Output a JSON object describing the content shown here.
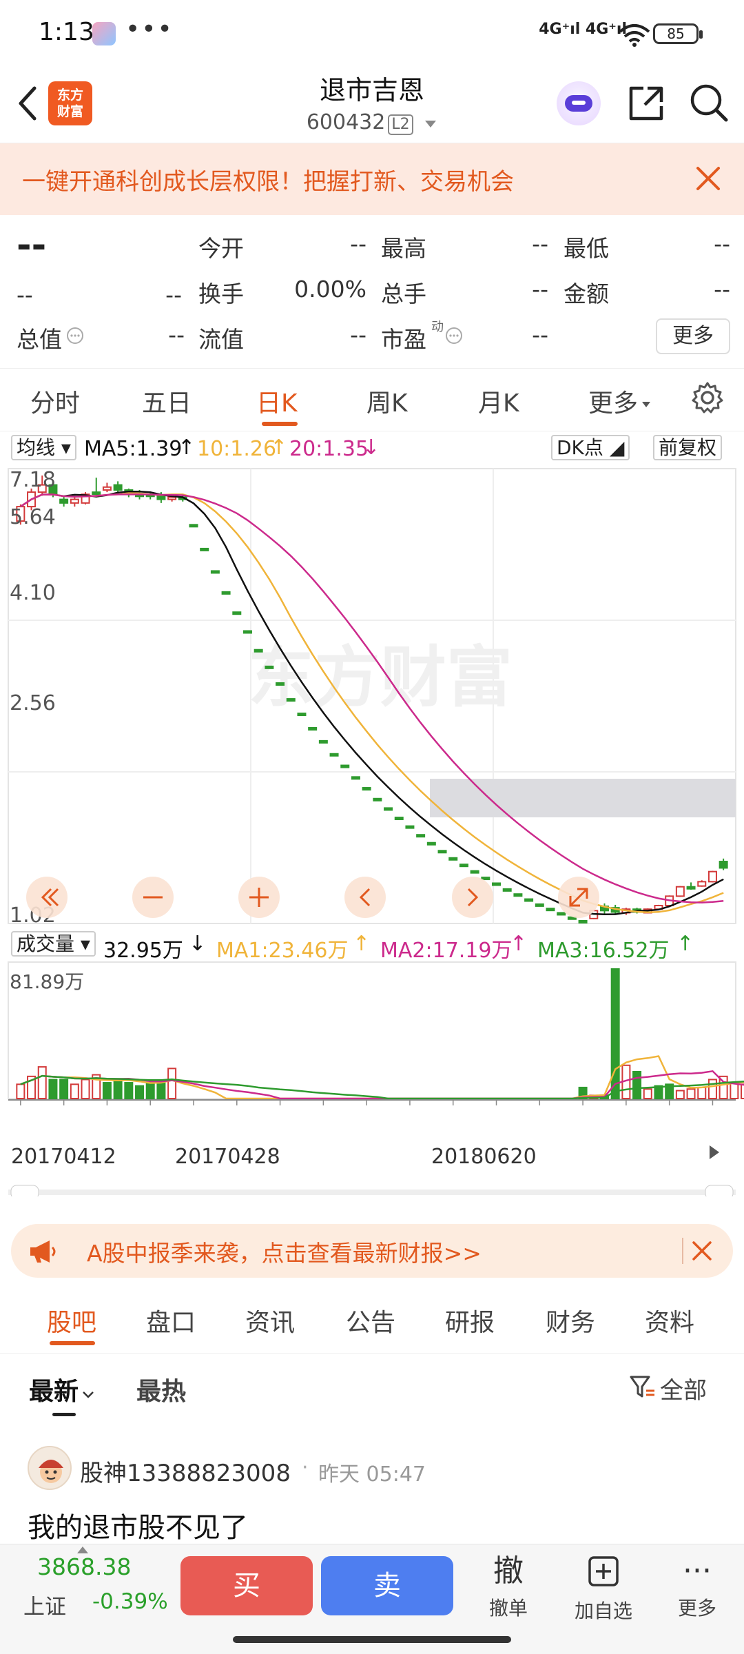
{
  "status_bar": {
    "time": "1:13",
    "dots": "•••",
    "network": "4G⁺ıl 4G⁺ıl",
    "battery": "85"
  },
  "header": {
    "logo_line1": "东方",
    "logo_line2": "财富",
    "stock_name": "退市吉恩",
    "stock_code": "600432",
    "level_badge": "L2"
  },
  "banner_top": {
    "text": "一键开通科创成长层权限！把握打新、交易机会"
  },
  "quote": {
    "price": "--",
    "change": "--",
    "change_pct": "--",
    "rows": [
      [
        {
          "label": "今开",
          "value": "--"
        },
        {
          "label": "最高",
          "value": "--"
        },
        {
          "label": "最低",
          "value": "--"
        }
      ],
      [
        {
          "label": "换手",
          "value": "0.00%"
        },
        {
          "label": "总手",
          "value": "--"
        },
        {
          "label": "金额",
          "value": "--"
        }
      ],
      [
        {
          "label": "流值",
          "value": "--"
        },
        {
          "label": "市盈",
          "value": "--"
        }
      ]
    ],
    "total_value_label": "总值",
    "total_value": "--",
    "pe_sup": "动",
    "more_label": "更多"
  },
  "k_tabs": [
    {
      "label": "分时"
    },
    {
      "label": "五日"
    },
    {
      "label": "日K"
    },
    {
      "label": "周K"
    },
    {
      "label": "月K"
    },
    {
      "label": "更多"
    }
  ],
  "ma_bar": {
    "selector": "均线",
    "ma5": "MA5:1.39",
    "ma10": "10:1.26",
    "ma20": "20:1.35",
    "dk": "DK点",
    "adjust": "前复权"
  },
  "colors": {
    "up": "#d33a3a",
    "down": "#2e9b2e",
    "ma5": "#111111",
    "ma10": "#f0b43a",
    "ma20": "#cc2a8c",
    "accent": "#e2591f"
  },
  "chart_data": [
    {
      "type": "candlestick",
      "y_labels": [
        "7.18",
        "5.64",
        "4.10",
        "2.56",
        "1.02"
      ],
      "ylim": [
        1.02,
        7.18
      ],
      "watermark": "东方财富",
      "candles": [
        {
          "o": 6.55,
          "c": 6.75,
          "h": 6.78,
          "l": 6.5
        },
        {
          "o": 6.75,
          "c": 6.95,
          "h": 7.0,
          "l": 6.7
        },
        {
          "o": 6.95,
          "c": 7.05,
          "h": 7.18,
          "l": 6.9
        },
        {
          "o": 7.05,
          "c": 6.92,
          "h": 7.1,
          "l": 6.88
        },
        {
          "o": 6.85,
          "c": 6.8,
          "h": 6.9,
          "l": 6.75
        },
        {
          "o": 6.8,
          "c": 6.85,
          "h": 6.9,
          "l": 6.75
        },
        {
          "o": 6.8,
          "c": 6.92,
          "h": 6.95,
          "l": 6.78
        },
        {
          "o": 6.95,
          "c": 6.95,
          "h": 7.15,
          "l": 6.9
        },
        {
          "o": 6.98,
          "c": 7.02,
          "h": 7.08,
          "l": 6.95
        },
        {
          "o": 7.05,
          "c": 6.98,
          "h": 7.1,
          "l": 6.95
        },
        {
          "o": 6.98,
          "c": 6.92,
          "h": 7.0,
          "l": 6.88
        },
        {
          "o": 6.92,
          "c": 6.92,
          "h": 6.98,
          "l": 6.85
        },
        {
          "o": 6.92,
          "c": 6.9,
          "h": 6.95,
          "l": 6.85
        },
        {
          "o": 6.9,
          "c": 6.85,
          "h": 6.95,
          "l": 6.8
        },
        {
          "o": 6.85,
          "c": 6.88,
          "h": 6.9,
          "l": 6.82
        },
        {
          "o": 6.88,
          "c": 6.85,
          "h": 6.9,
          "l": 6.82
        },
        {
          "o": 6.5,
          "c": 6.5,
          "h": 6.5,
          "l": 6.5
        },
        {
          "o": 6.17,
          "c": 6.17,
          "h": 6.17,
          "l": 6.17
        },
        {
          "o": 5.86,
          "c": 5.86,
          "h": 5.86,
          "l": 5.86
        },
        {
          "o": 5.57,
          "c": 5.57,
          "h": 5.57,
          "l": 5.57
        },
        {
          "o": 5.29,
          "c": 5.29,
          "h": 5.29,
          "l": 5.29
        },
        {
          "o": 5.03,
          "c": 5.03,
          "h": 5.03,
          "l": 5.03
        },
        {
          "o": 4.77,
          "c": 4.77,
          "h": 4.77,
          "l": 4.77
        },
        {
          "o": 4.54,
          "c": 4.54,
          "h": 4.54,
          "l": 4.54
        },
        {
          "o": 4.31,
          "c": 4.31,
          "h": 4.31,
          "l": 4.31
        },
        {
          "o": 4.09,
          "c": 4.09,
          "h": 4.09,
          "l": 4.09
        },
        {
          "o": 3.89,
          "c": 3.89,
          "h": 3.89,
          "l": 3.89
        },
        {
          "o": 3.69,
          "c": 3.69,
          "h": 3.69,
          "l": 3.69
        },
        {
          "o": 3.51,
          "c": 3.51,
          "h": 3.51,
          "l": 3.51
        },
        {
          "o": 3.33,
          "c": 3.33,
          "h": 3.33,
          "l": 3.33
        },
        {
          "o": 3.17,
          "c": 3.17,
          "h": 3.17,
          "l": 3.17
        },
        {
          "o": 3.01,
          "c": 3.01,
          "h": 3.01,
          "l": 3.01
        },
        {
          "o": 2.86,
          "c": 2.86,
          "h": 2.86,
          "l": 2.86
        },
        {
          "o": 2.71,
          "c": 2.71,
          "h": 2.71,
          "l": 2.71
        },
        {
          "o": 2.58,
          "c": 2.58,
          "h": 2.58,
          "l": 2.58
        },
        {
          "o": 2.45,
          "c": 2.45,
          "h": 2.45,
          "l": 2.45
        },
        {
          "o": 2.33,
          "c": 2.33,
          "h": 2.33,
          "l": 2.33
        },
        {
          "o": 2.21,
          "c": 2.21,
          "h": 2.21,
          "l": 2.21
        },
        {
          "o": 2.1,
          "c": 2.1,
          "h": 2.1,
          "l": 2.1
        },
        {
          "o": 1.99,
          "c": 1.99,
          "h": 1.99,
          "l": 1.99
        },
        {
          "o": 1.89,
          "c": 1.89,
          "h": 1.89,
          "l": 1.89
        },
        {
          "o": 1.8,
          "c": 1.8,
          "h": 1.8,
          "l": 1.8
        },
        {
          "o": 1.71,
          "c": 1.71,
          "h": 1.71,
          "l": 1.71
        },
        {
          "o": 1.62,
          "c": 1.62,
          "h": 1.62,
          "l": 1.62
        },
        {
          "o": 1.54,
          "c": 1.54,
          "h": 1.54,
          "l": 1.54
        },
        {
          "o": 1.46,
          "c": 1.46,
          "h": 1.46,
          "l": 1.46
        },
        {
          "o": 1.39,
          "c": 1.39,
          "h": 1.39,
          "l": 1.39
        },
        {
          "o": 1.32,
          "c": 1.32,
          "h": 1.32,
          "l": 1.32
        },
        {
          "o": 1.25,
          "c": 1.25,
          "h": 1.25,
          "l": 1.25
        },
        {
          "o": 1.19,
          "c": 1.19,
          "h": 1.19,
          "l": 1.19
        },
        {
          "o": 1.13,
          "c": 1.13,
          "h": 1.13,
          "l": 1.13
        },
        {
          "o": 1.07,
          "c": 1.07,
          "h": 1.07,
          "l": 1.07
        },
        {
          "o": 1.02,
          "c": 1.02,
          "h": 1.02,
          "l": 1.02
        },
        {
          "o": 1.05,
          "c": 1.16,
          "h": 1.17,
          "l": 1.04
        },
        {
          "o": 1.22,
          "c": 1.16,
          "h": 1.26,
          "l": 1.12
        },
        {
          "o": 1.2,
          "c": 1.14,
          "h": 1.24,
          "l": 1.11
        },
        {
          "o": 1.13,
          "c": 1.18,
          "h": 1.2,
          "l": 1.1
        },
        {
          "o": 1.18,
          "c": 1.14,
          "h": 1.2,
          "l": 1.12
        },
        {
          "o": 1.13,
          "c": 1.18,
          "h": 1.19,
          "l": 1.12
        },
        {
          "o": 1.18,
          "c": 1.23,
          "h": 1.24,
          "l": 1.17
        },
        {
          "o": 1.23,
          "c": 1.36,
          "h": 1.37,
          "l": 1.22
        },
        {
          "o": 1.36,
          "c": 1.49,
          "h": 1.5,
          "l": 1.35
        },
        {
          "o": 1.49,
          "c": 1.47,
          "h": 1.55,
          "l": 1.45
        },
        {
          "o": 1.5,
          "c": 1.56,
          "h": 1.58,
          "l": 1.49
        },
        {
          "o": 1.56,
          "c": 1.7,
          "h": 1.71,
          "l": 1.55
        },
        {
          "o": 1.84,
          "c": 1.75,
          "h": 1.88,
          "l": 1.72
        }
      ]
    },
    {
      "type": "bar",
      "title": "成交量",
      "current": "32.95万",
      "ma1": "MA1:23.46万",
      "ma2": "MA2:17.19万",
      "ma3": "MA3:16.52万",
      "max_label": "81.89万",
      "ylim": [
        0,
        81.89
      ],
      "x_labels": [
        "20170412",
        "20170428",
        "20180620"
      ],
      "volumes": [
        9,
        14,
        20,
        12,
        12,
        9,
        12,
        15,
        10,
        11,
        10,
        8,
        10,
        11,
        19,
        0,
        0,
        0,
        0,
        0,
        0,
        0,
        0,
        0,
        0,
        0,
        0,
        0,
        0,
        0,
        0,
        0,
        0,
        0,
        0,
        0,
        0,
        0,
        0,
        0,
        0,
        0,
        0,
        0,
        0,
        0,
        0,
        0,
        0,
        0,
        0,
        0,
        7,
        2,
        2,
        81.89,
        21,
        17,
        6,
        8,
        9,
        5,
        6,
        7,
        12,
        14,
        10,
        9,
        9,
        25
      ],
      "volume_colors": [
        "up",
        "up",
        "up",
        "down",
        "down",
        "up",
        "up",
        "up",
        "down",
        "down",
        "down",
        "down",
        "down",
        "down",
        "up",
        "down",
        "down",
        "down",
        "down",
        "down",
        "down",
        "down",
        "down",
        "down",
        "down",
        "down",
        "down",
        "down",
        "down",
        "down",
        "down",
        "down",
        "down",
        "down",
        "down",
        "down",
        "down",
        "down",
        "down",
        "down",
        "down",
        "down",
        "down",
        "down",
        "down",
        "down",
        "down",
        "down",
        "down",
        "down",
        "down",
        "down",
        "down",
        "up",
        "down",
        "down",
        "up",
        "down",
        "up",
        "down",
        "down",
        "up",
        "up",
        "up",
        "up",
        "up",
        "up",
        "up",
        "up",
        "up"
      ]
    }
  ],
  "news_banner": {
    "text": "A股中报季来袭，点击查看最新财报>>"
  },
  "sub_tabs": [
    {
      "label": "股吧"
    },
    {
      "label": "盘口"
    },
    {
      "label": "资讯"
    },
    {
      "label": "公告"
    },
    {
      "label": "研报"
    },
    {
      "label": "财务"
    },
    {
      "label": "资料"
    }
  ],
  "filter": {
    "latest": "最新",
    "hot": "最热",
    "all": "全部"
  },
  "post": {
    "author": "股神13388823008",
    "sep": "·",
    "time": "昨天 05:47",
    "content": "我的退市股不见了"
  },
  "bottom": {
    "index_value": "3868.38",
    "index_name": "上证",
    "index_change": "-0.39%",
    "buy": "买",
    "sell": "卖",
    "cancel_big": "撤",
    "cancel_small": "撤单",
    "add_watch": "加自选",
    "more": "更多"
  }
}
